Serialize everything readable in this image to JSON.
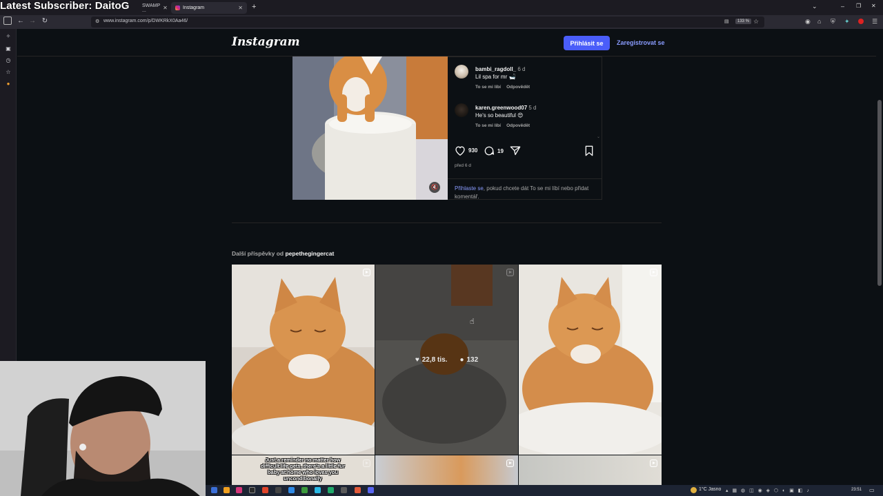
{
  "overlay": {
    "title": "Latest Subscriber: DaitoG"
  },
  "browser": {
    "tabs": [
      {
        "label": "SWAMP ...",
        "active": false
      },
      {
        "label": "Instagram",
        "active": true
      }
    ],
    "new_tab": "+",
    "url": "www.instagram.com/p/DWKRkX0Aa46/",
    "zoom": "133 %"
  },
  "header": {
    "logo": "Instagram",
    "login_button": "Přihlásit se",
    "register_link": "Zaregistrovat se"
  },
  "post": {
    "comments": [
      {
        "user": "bambi_ragdoll_",
        "time": "6 d",
        "text": "Lil spa for mr 🛁",
        "like_action": "To se mi líbí",
        "reply_action": "Odpovědět"
      },
      {
        "user": "karen.greenwood07",
        "time": "5 d",
        "text": "He's so beautiful 😍",
        "like_action": "To se mi líbí",
        "reply_action": "Odpovědět"
      }
    ],
    "likes": "930",
    "comments_count": "19",
    "date": "před 6 d",
    "login_prompt_link": "Přihlaste se",
    "login_prompt_rest": ", pokud chcete dát To se mi líbí nebo přidat komentář."
  },
  "more_posts": {
    "prefix": "Další příspěvky od ",
    "user": "pepethegingercat"
  },
  "grid": {
    "hover_likes": "22,8 tis.",
    "hover_comments": "132",
    "caption": "Just a reminder no matter how difficult life gets, there's a little fur baby at home who loves you unconditionally"
  },
  "taskbar": {
    "weather": "1°C  Jasno",
    "clock": "23:51"
  },
  "colors": {
    "accent": "#4a5df9",
    "link": "#8a9cff",
    "background": "#0c1014"
  }
}
